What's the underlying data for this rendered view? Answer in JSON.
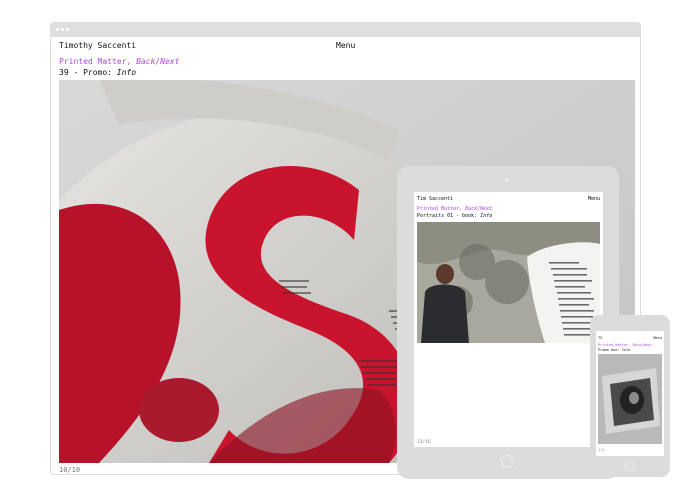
{
  "colors": {
    "accent": "#b04ae0",
    "text": "#111111",
    "frame": "#dcdcdc"
  },
  "desktop": {
    "site_name": "Timothy Saccenti",
    "menu": "Menu",
    "section": "Printed Matter, ",
    "nav": "Back/Next",
    "project": "39 - Promo: ",
    "info": "Info",
    "counter": "10/10"
  },
  "tablet": {
    "site_name": "Tim Saccenti",
    "menu": "Menu",
    "section": "Printed Matter, ",
    "nav": "Back/Next",
    "project": "Portraits 01 - book: ",
    "info": "Info",
    "counter": "13/16"
  },
  "phone": {
    "site_name": "TS",
    "menu": "Menu",
    "section": "Printed Matter, ",
    "nav": "Back/Next",
    "project": "Promo One: ",
    "info": "Info",
    "counter": "1/2"
  }
}
